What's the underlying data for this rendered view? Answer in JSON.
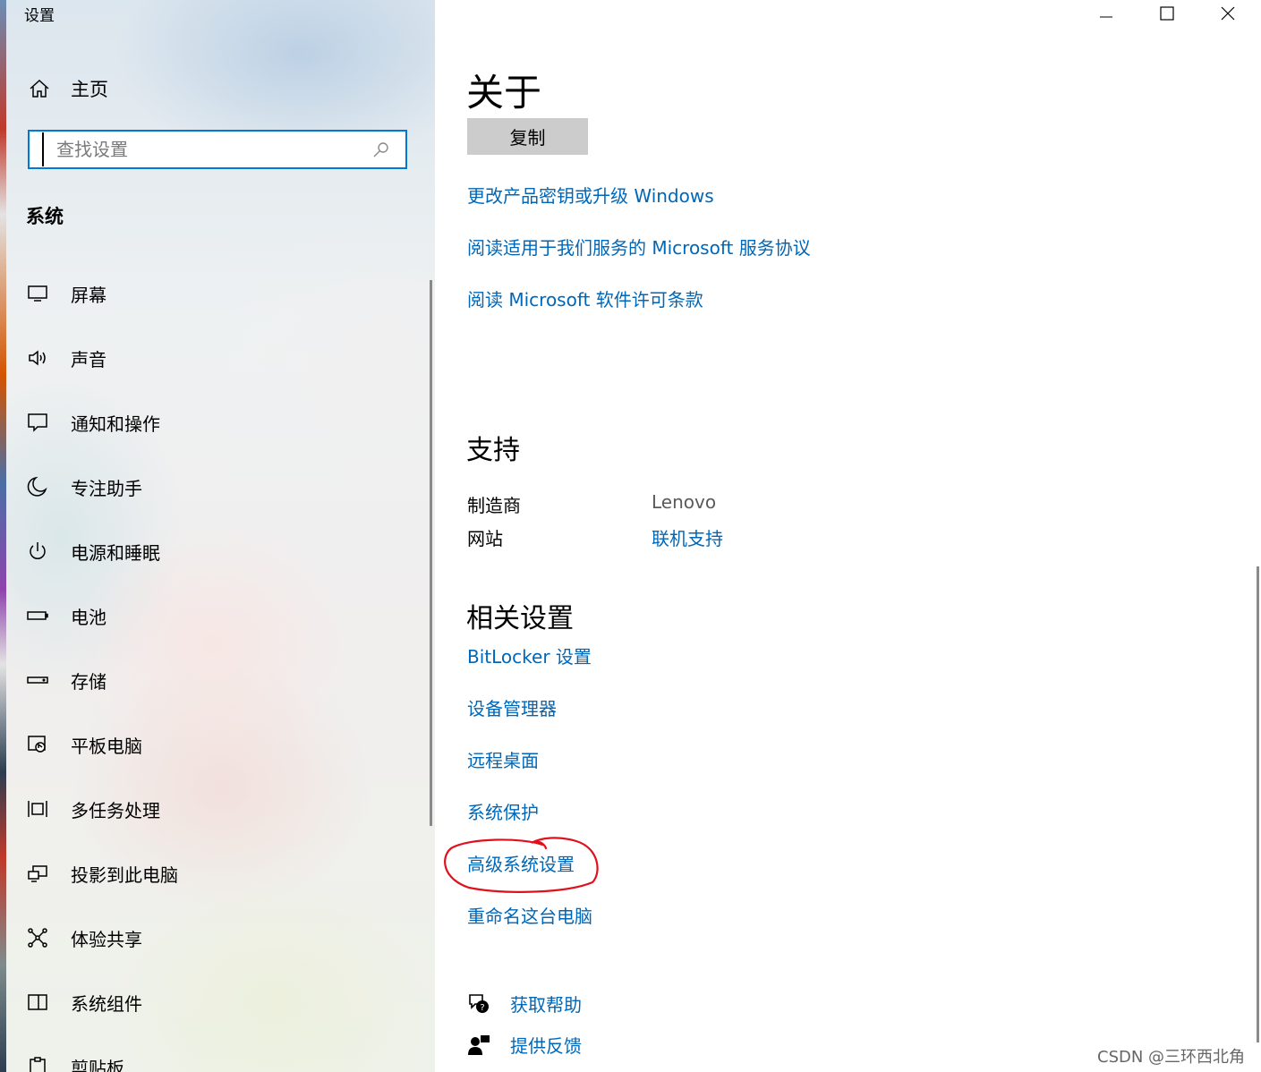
{
  "window": {
    "title": "设置"
  },
  "sidebar": {
    "home_label": "主页",
    "search_placeholder": "查找设置",
    "section_label": "系统",
    "items": [
      {
        "label": "屏幕",
        "icon": "monitor-icon"
      },
      {
        "label": "声音",
        "icon": "speaker-icon"
      },
      {
        "label": "通知和操作",
        "icon": "notification-icon"
      },
      {
        "label": "专注助手",
        "icon": "moon-icon"
      },
      {
        "label": "电源和睡眠",
        "icon": "power-icon"
      },
      {
        "label": "电池",
        "icon": "battery-icon"
      },
      {
        "label": "存储",
        "icon": "storage-icon"
      },
      {
        "label": "平板电脑",
        "icon": "tablet-icon"
      },
      {
        "label": "多任务处理",
        "icon": "multitask-icon"
      },
      {
        "label": "投影到此电脑",
        "icon": "project-icon"
      },
      {
        "label": "体验共享",
        "icon": "share-icon"
      },
      {
        "label": "系统组件",
        "icon": "components-icon"
      },
      {
        "label": "剪贴板",
        "icon": "clipboard-icon"
      }
    ]
  },
  "main": {
    "title": "关于",
    "copy_button": "复制",
    "links": [
      "更改产品密钥或升级 Windows",
      "阅读适用于我们服务的 Microsoft 服务协议",
      "阅读 Microsoft 软件许可条款"
    ],
    "support": {
      "heading": "支持",
      "manufacturer_label": "制造商",
      "manufacturer_value": "Lenovo",
      "website_label": "网站",
      "website_value": "联机支持"
    },
    "related": {
      "heading": "相关设置",
      "links": [
        "BitLocker 设置",
        "设备管理器",
        "远程桌面",
        "系统保护",
        "高级系统设置",
        "重命名这台电脑"
      ]
    },
    "help": {
      "get_help": "获取帮助",
      "feedback": "提供反馈"
    }
  },
  "watermark": "CSDN @三环西北角",
  "colors": {
    "accent": "#0078d7",
    "link": "#0067b8",
    "annotation": "#e0101c"
  }
}
